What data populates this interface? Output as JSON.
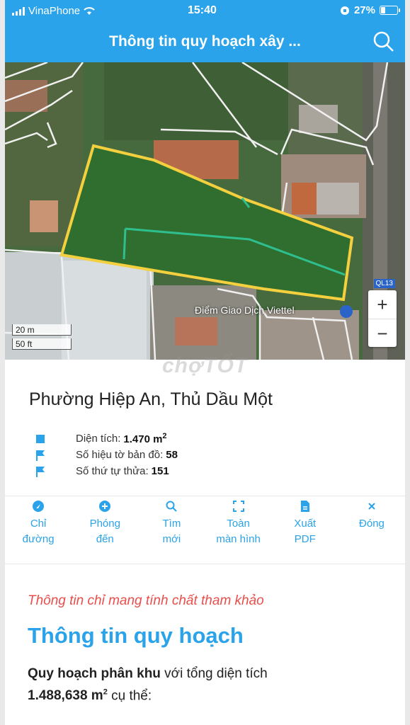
{
  "status_bar": {
    "carrier": "VinaPhone",
    "time": "15:40",
    "battery": "27%",
    "battery_level": 0.27
  },
  "header": {
    "title": "Thông tin quy hoạch xây ...",
    "search_icon": "search-icon"
  },
  "map": {
    "scale_m": "20 m",
    "scale_ft": "50 ft",
    "poi_label": "Điểm Giao Dịch Viettel",
    "road_tag": "QL13",
    "zoom_in": "+",
    "zoom_out": "−",
    "watermark": "chợTỐT",
    "parcel_outline_color": "#f4d03f",
    "zone_outline_color": "#2fbf8f"
  },
  "place": {
    "name": "Phường Hiệp An, Thủ Dầu Một",
    "area_label": "Diện tích:",
    "area_value": "1.470 m",
    "area_unit_sup": "2",
    "sheet_label": "Số hiệu tờ bản đồ:",
    "sheet_value": "58",
    "parcel_label": "Số thứ tự thửa:",
    "parcel_value": "151"
  },
  "actions": [
    {
      "line1": "Chỉ",
      "line2": "đường",
      "icon": "directions-icon"
    },
    {
      "line1": "Phóng",
      "line2": "đến",
      "icon": "zoom-to-icon"
    },
    {
      "line1": "Tìm",
      "line2": "mới",
      "icon": "search-icon"
    },
    {
      "line1": "Toàn",
      "line2": "màn hình",
      "icon": "fullscreen-icon"
    },
    {
      "line1": "Xuất",
      "line2": "PDF",
      "icon": "pdf-icon"
    },
    {
      "line1": "Đóng",
      "line2": "",
      "icon": "close-icon"
    }
  ],
  "content": {
    "note": "Thông tin chỉ mang tính chất tham khảo",
    "heading": "Thông tin quy hoạch",
    "desc_bold": "Quy hoạch phân khu",
    "desc_rest": " với tổng diện tích",
    "desc_area": "1.488,638 m",
    "desc_area_sup": "2",
    "desc_tail": " cụ thể:"
  },
  "colors": {
    "accent": "#2aa3ea",
    "note_red": "#e94e4a"
  }
}
